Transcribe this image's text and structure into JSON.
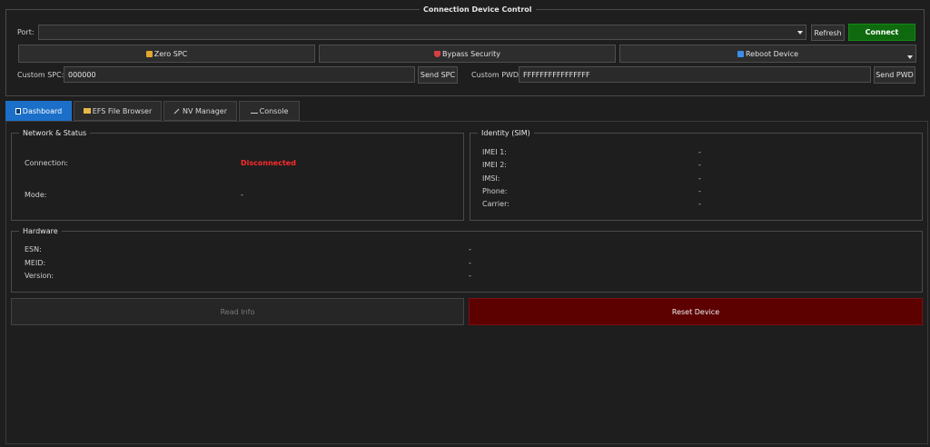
{
  "connection": {
    "title": "Connection  Device Control",
    "port_label": "Port:",
    "port_value": "",
    "refresh_label": "Refresh",
    "connect_label": "Connect",
    "zero_spc_label": "Zero SPC",
    "bypass_label": "Bypass Security",
    "reboot_label": "Reboot Device",
    "custom_spc_label": "Custom SPC:",
    "custom_spc_value": "000000",
    "send_spc_label": "Send SPC",
    "custom_pwd_label": "Custom PWD:",
    "custom_pwd_value": "FFFFFFFFFFFFFFFF",
    "send_pwd_label": "Send PWD"
  },
  "tabs": [
    {
      "label": "Dashboard",
      "icon": "dashboard-icon",
      "active": true
    },
    {
      "label": "EFS File Browser",
      "icon": "folder-icon",
      "active": false
    },
    {
      "label": "NV Manager",
      "icon": "pen-icon",
      "active": false
    },
    {
      "label": "Console",
      "icon": "console-icon",
      "active": false
    }
  ],
  "network": {
    "title": "Network & Status",
    "connection_label": "Connection:",
    "connection_value": "Disconnected",
    "mode_label": "Mode:",
    "mode_value": "-"
  },
  "identity": {
    "title": "Identity (SIM)",
    "rows": [
      {
        "label": "IMEI 1:",
        "value": "-"
      },
      {
        "label": "IMEI 2:",
        "value": "-"
      },
      {
        "label": "IMSI:",
        "value": "-"
      },
      {
        "label": "Phone:",
        "value": "-"
      },
      {
        "label": "Carrier:",
        "value": "-"
      }
    ]
  },
  "hardware": {
    "title": "Hardware",
    "rows": [
      {
        "label": "ESN:",
        "value": "-"
      },
      {
        "label": "MEID:",
        "value": "-"
      },
      {
        "label": "Version:",
        "value": "-"
      }
    ]
  },
  "actions": {
    "read_info_label": "Read Info",
    "reset_device_label": "Reset Device"
  },
  "colors": {
    "accent_blue": "#1b6fc8",
    "connect_green": "#0f6a0f",
    "disconnected_red": "#ff2a2a",
    "reset_red": "#5c0000"
  }
}
